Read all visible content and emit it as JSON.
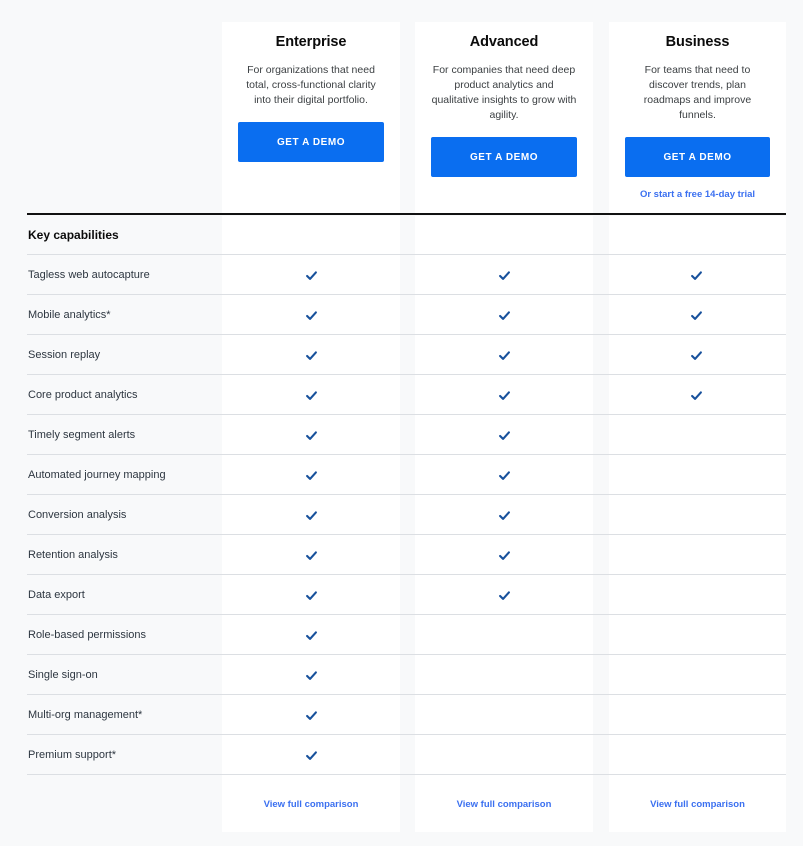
{
  "theme": {
    "page_background": "#f8f9fa",
    "card_background": "#ffffff",
    "button_blue": "#0a6ef0",
    "link_blue": "#3b70f0",
    "check_blue": "#18519c",
    "rule_black": "#111111",
    "divider_gray": "#dcdfe3"
  },
  "plans": [
    {
      "name": "Enterprise",
      "description": "For organizations that need total, cross-functional clarity into their digital portfolio.",
      "cta_label": "GET A DEMO",
      "trial_link": null,
      "footer_link": "View full comparison"
    },
    {
      "name": "Advanced",
      "description": "For companies that need deep product analytics and qualitative insights to grow with agility.",
      "cta_label": "GET A DEMO",
      "trial_link": null,
      "footer_link": "View full comparison"
    },
    {
      "name": "Business",
      "description": "For teams that need to discover trends, plan roadmaps and improve funnels.",
      "cta_label": "GET A DEMO",
      "trial_link": "Or start a free 14-day trial",
      "footer_link": "View full comparison"
    }
  ],
  "table": {
    "section_title": "Key capabilities",
    "columns": [
      "Enterprise",
      "Advanced",
      "Business"
    ],
    "rows": [
      {
        "label": "Tagless web autocapture",
        "values": [
          true,
          true,
          true
        ]
      },
      {
        "label": "Mobile analytics*",
        "values": [
          true,
          true,
          true
        ]
      },
      {
        "label": "Session replay",
        "values": [
          true,
          true,
          true
        ]
      },
      {
        "label": "Core product analytics",
        "values": [
          true,
          true,
          true
        ]
      },
      {
        "label": "Timely segment alerts",
        "values": [
          true,
          true,
          false
        ]
      },
      {
        "label": "Automated journey mapping",
        "values": [
          true,
          true,
          false
        ]
      },
      {
        "label": "Conversion analysis",
        "values": [
          true,
          true,
          false
        ]
      },
      {
        "label": "Retention analysis",
        "values": [
          true,
          true,
          false
        ]
      },
      {
        "label": "Data export",
        "values": [
          true,
          true,
          false
        ]
      },
      {
        "label": "Role-based permissions",
        "values": [
          true,
          false,
          false
        ]
      },
      {
        "label": "Single sign-on",
        "values": [
          true,
          false,
          false
        ]
      },
      {
        "label": "Multi-org management*",
        "values": [
          true,
          false,
          false
        ]
      },
      {
        "label": "Premium support*",
        "values": [
          true,
          false,
          false
        ]
      }
    ]
  }
}
